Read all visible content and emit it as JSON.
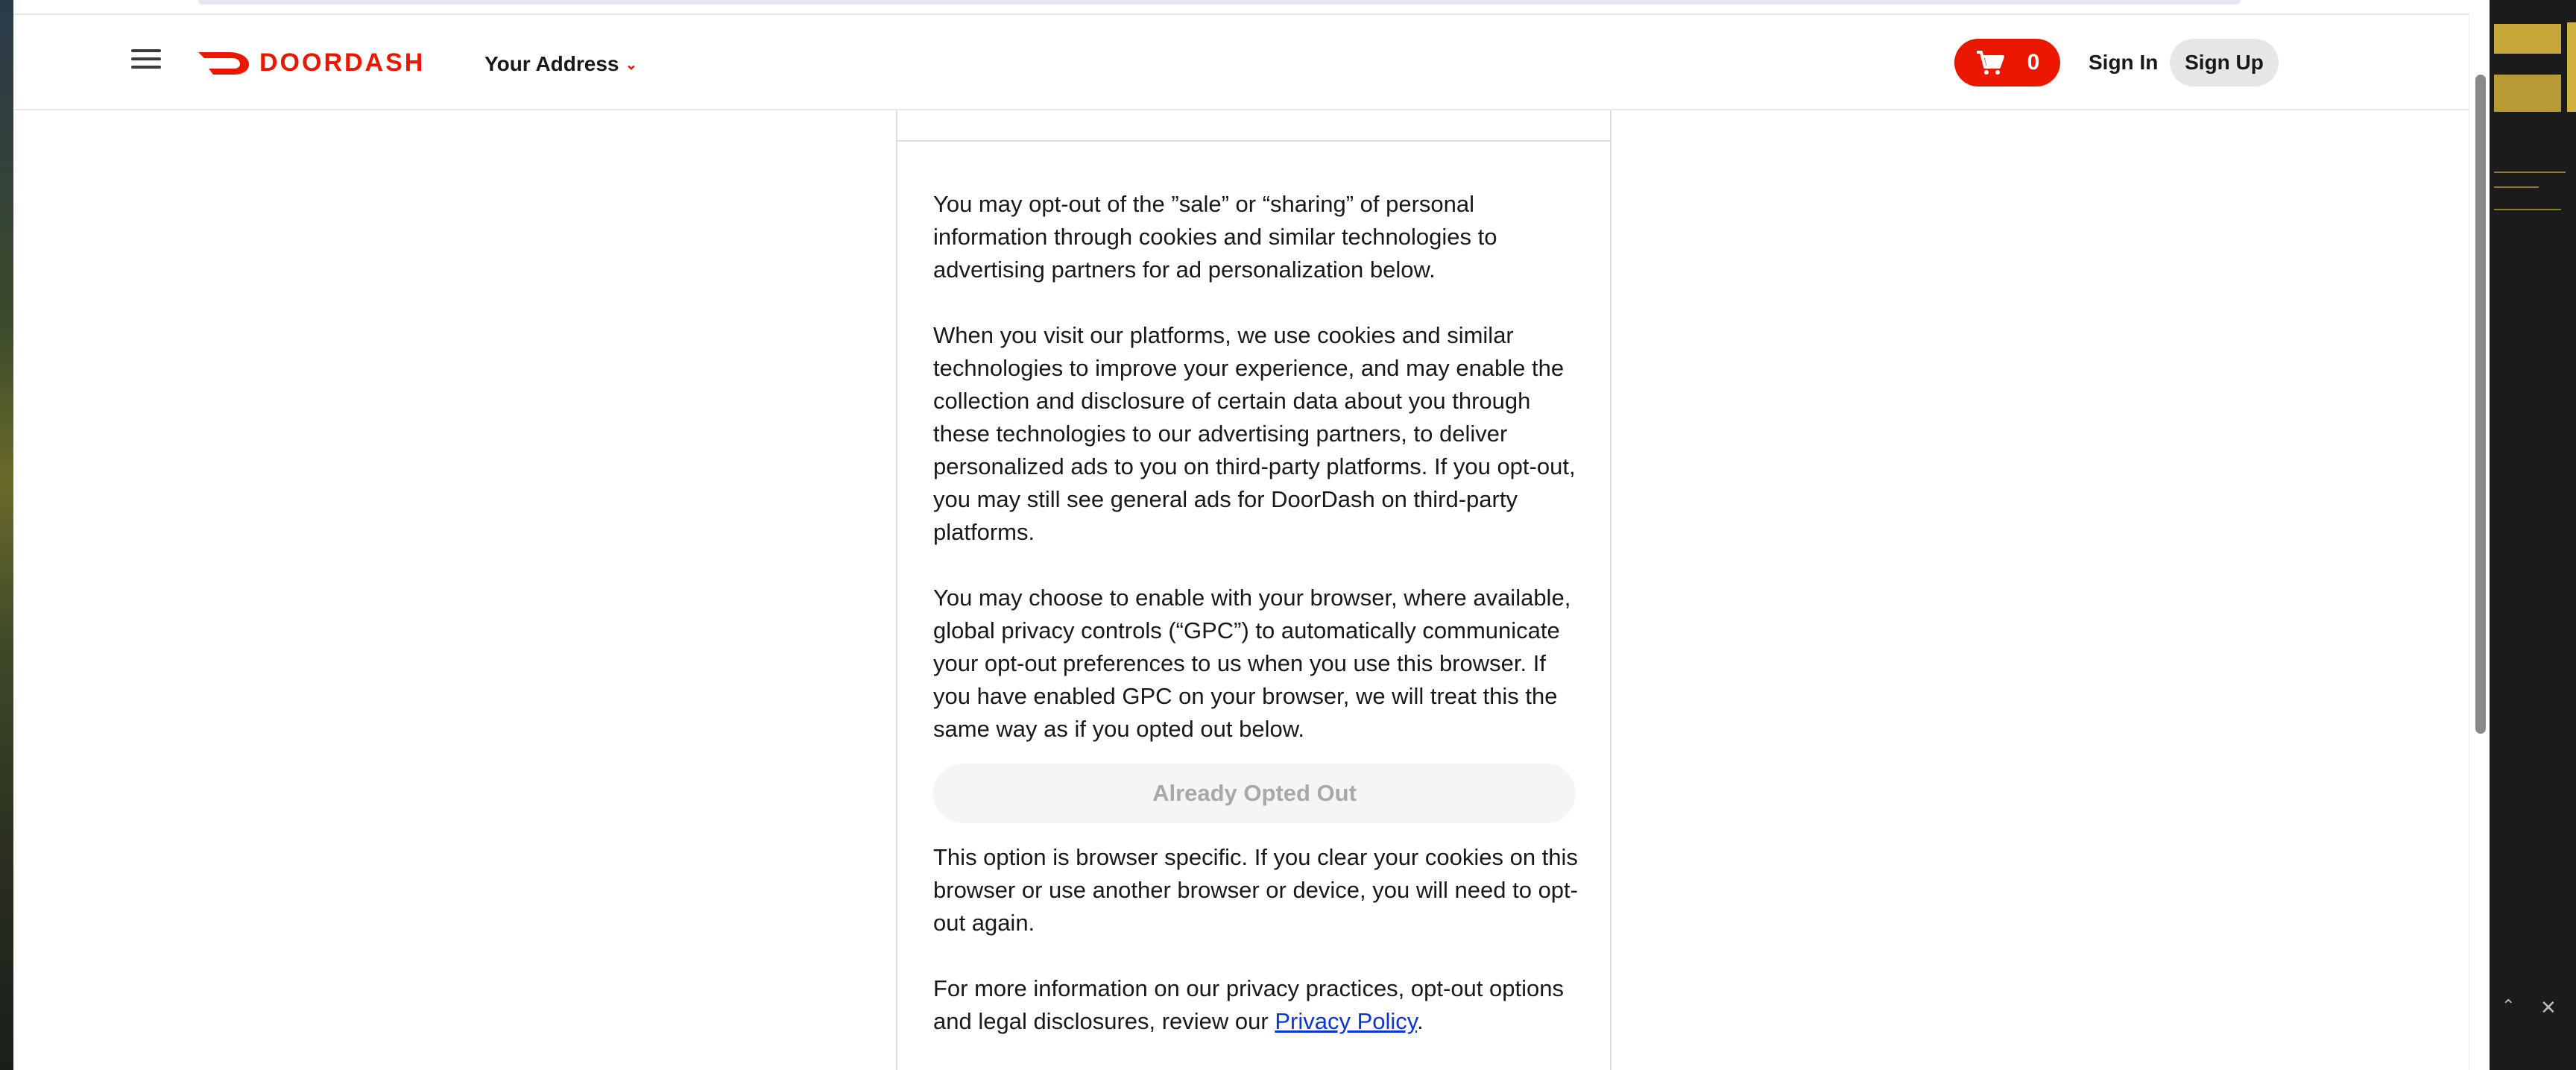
{
  "header": {
    "brand": "DOORDASH",
    "address_label": "Your Address",
    "cart_count": "0",
    "sign_in": "Sign In",
    "sign_up": "Sign Up"
  },
  "panel": {
    "para1": "You may opt-out of the ”sale” or “sharing” of personal information through cookies and similar technologies to advertising partners for ad personalization below.",
    "para2": "When you visit our platforms, we use cookies and similar technologies to improve your experience, and may enable the collection and disclosure of certain data about you through these technologies to our advertising partners, to deliver personalized ads to you on third-party platforms. If you opt-out, you may still see general ads for DoorDash on third-party platforms.",
    "para3": "You may choose to enable with your browser, where available, global privacy controls (“GPC”) to automatically communicate your opt-out preferences to us when you use this browser. If you have enabled GPC on your browser, we will treat this the same way as if you opted out below.",
    "opt_out_button": "Already Opted Out",
    "para4": "This option is browser specific. If you clear your cookies on this browser or use another browser or device, you will need to opt-out again.",
    "para5_prefix": "For more information on our privacy practices, opt-out options and legal disclosures, review our ",
    "privacy_link": "Privacy Policy",
    "para5_suffix": "."
  },
  "colors": {
    "brand_red": "#eb1700",
    "link_blue": "#0b36d6"
  },
  "icons": {
    "menu": "hamburger-icon",
    "cart": "cart-icon",
    "chevron": "chevron-down-icon"
  }
}
